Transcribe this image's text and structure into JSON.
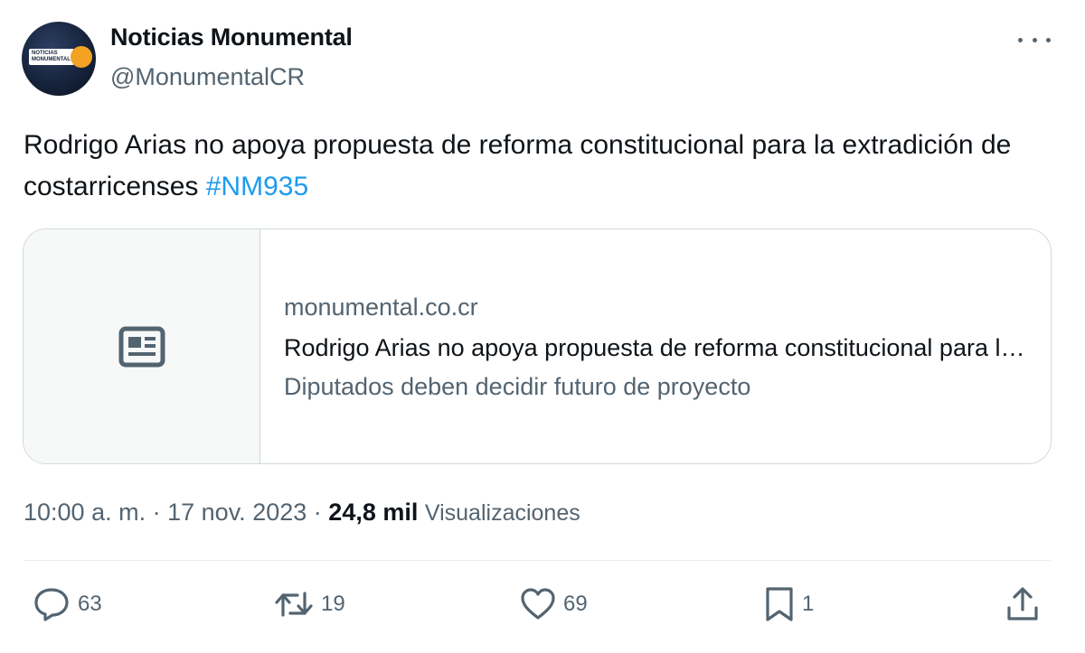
{
  "account": {
    "avatar_text": "NOTICIAS MONUMENTAL",
    "display_name": "Noticias Monumental",
    "handle": "@MonumentalCR"
  },
  "tweet": {
    "text": "Rodrigo Arias no apoya propuesta de reforma constitucional para la extradición de costarricenses",
    "hashtag": "#NM935"
  },
  "link_card": {
    "domain": "monumental.co.cr",
    "title": "Rodrigo Arias no apoya propuesta de reforma constitucional para la extradición de costarricenses",
    "description": "Diputados deben decidir futuro de proyecto",
    "thumbnail_icon": "news-article-icon"
  },
  "meta": {
    "time": "10:00 a. m.",
    "separator": "·",
    "date": "17 nov. 2023",
    "views_count": "24,8 mil",
    "views_label": "Visualizaciones"
  },
  "actions": {
    "replies": "63",
    "reposts": "19",
    "likes": "69",
    "bookmarks": "1"
  },
  "colors": {
    "text_primary": "#0f1419",
    "text_secondary": "#536471",
    "link": "#1d9bf0",
    "border": "#cfd9de"
  }
}
